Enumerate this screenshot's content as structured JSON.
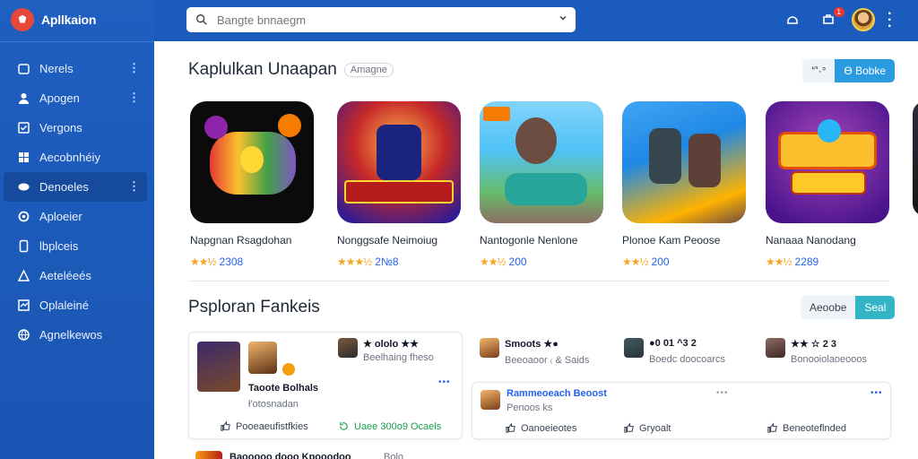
{
  "app": {
    "name": "Apllkaion"
  },
  "sidebar": {
    "items": [
      {
        "label": "Nerels",
        "icon": "home-icon",
        "active": false,
        "more": true
      },
      {
        "label": "Apogen",
        "icon": "user-icon",
        "active": false,
        "more": true
      },
      {
        "label": "Vergons",
        "icon": "check-icon",
        "active": false,
        "more": false
      },
      {
        "label": "Aecobnhéiy",
        "icon": "grid-icon",
        "active": false,
        "more": false
      },
      {
        "label": "Denoeles",
        "icon": "gamepad-icon",
        "active": true,
        "more": true
      },
      {
        "label": "Aploeier",
        "icon": "settings-icon",
        "active": false,
        "more": false
      },
      {
        "label": "lbplceis",
        "icon": "phone-icon",
        "active": false,
        "more": false
      },
      {
        "label": "Aeteléeés",
        "icon": "chart-icon",
        "active": false,
        "more": false
      },
      {
        "label": "Oplaleiné",
        "icon": "tag-icon",
        "active": false,
        "more": false
      },
      {
        "label": "Agnelkewos",
        "icon": "globe-icon",
        "active": false,
        "more": false
      }
    ]
  },
  "topbar": {
    "search_placeholder": "Bangte bnnaegm",
    "notification_count": "1"
  },
  "featured": {
    "title": "Kaplulkan Unaapan",
    "chip": "Amagne",
    "seg_left": "ᔥ·ᐣ",
    "seg_right": "Ɵ Bobke",
    "games": [
      {
        "name": "Napgnan Rsagdohan",
        "rating": "2308",
        "stars": "★★½"
      },
      {
        "name": "Nonggsafe Neimoiug",
        "rating": "2№8",
        "stars": "★★★½"
      },
      {
        "name": "Nantogonle Nenlone",
        "rating": "200",
        "stars": "★★½"
      },
      {
        "name": "Plonoe Kam Peoose",
        "rating": "200",
        "stars": "★★½"
      },
      {
        "name": "Nanaaa Nanodang",
        "rating": "2289",
        "stars": "★★½"
      }
    ]
  },
  "rankings": {
    "title": "Psploran Fankeis",
    "seg_left": "Aeoobe",
    "seg_right": "Seal",
    "card1": {
      "title": "Taoote Bolhals",
      "subtitle": "ƚ'otosnadan",
      "side_title": "★ ololo ★★",
      "side_sub": "Beelhaing fheso",
      "action_left": "Pooeaeufistfkies",
      "action_right": "Uaee 300o9 Ocaels"
    },
    "mid_items": [
      {
        "title": "Smoots ★●",
        "sub": "Beeoaoor ₍ & Saids"
      },
      {
        "title": "●0 01 ^3 2",
        "sub": "Boedc doocoarcs"
      },
      {
        "title": "★★ ☆ 2 3",
        "sub": "Bonooiolaoeooos"
      }
    ],
    "card2": {
      "title": "Rammeoeach Beoost",
      "sub": "Penoos ks",
      "actions": [
        "Oanoeieotes",
        "Gryoalt",
        "Beneoteflnded"
      ]
    },
    "bottom": {
      "left": "Baooooo dooo Kpooodoo",
      "right": "Bolo"
    }
  },
  "colors": {
    "sidebar": "#1a56b3",
    "topbar": "#1b5bbd",
    "accent": "#2a9be0",
    "teal": "#34b5c6",
    "star": "#f5a623"
  }
}
